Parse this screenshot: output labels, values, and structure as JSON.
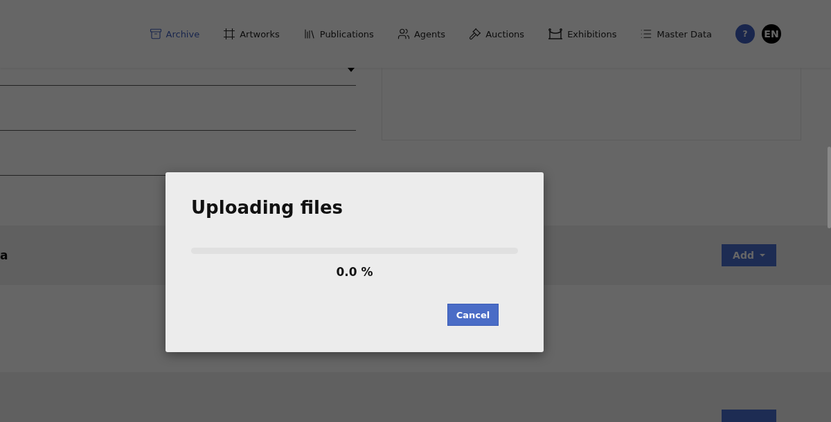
{
  "nav": {
    "items": [
      {
        "label": "Archive",
        "selected": true
      },
      {
        "label": "Artworks",
        "selected": false
      },
      {
        "label": "Publications",
        "selected": false
      },
      {
        "label": "Agents",
        "selected": false
      },
      {
        "label": "Auctions",
        "selected": false
      },
      {
        "label": "Exhibitions",
        "selected": false
      },
      {
        "label": "Master Data",
        "selected": false
      }
    ],
    "help": "?",
    "language": "EN"
  },
  "sections": [
    {
      "title": "a",
      "button": "Add"
    }
  ],
  "dialog": {
    "title": "Uploading files",
    "progress": {
      "level": 0
    },
    "percent": "0.0 %",
    "cancel": "Cancel"
  }
}
